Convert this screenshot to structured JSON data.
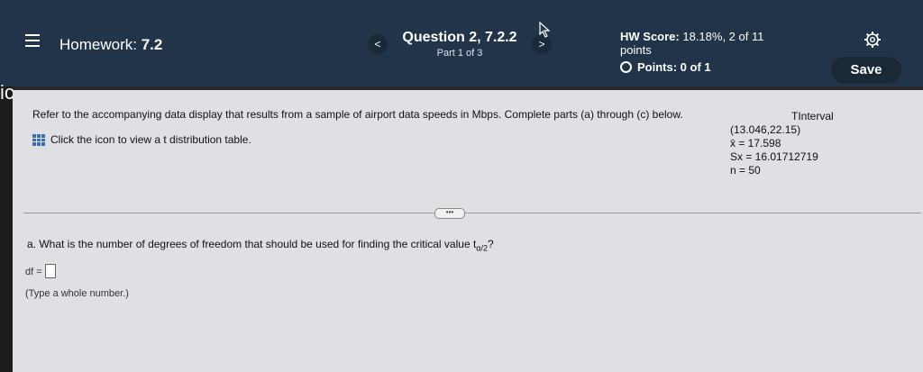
{
  "header": {
    "homework_label": "Homework:",
    "homework_number": "7.2",
    "question_title": "Question 2, 7.2.2",
    "question_part": "Part 1 of 3",
    "prev_label": "<",
    "next_label": ">",
    "hw_score_label": "HW Score:",
    "hw_score_value": "18.18%, 2 of 11",
    "hw_score_points_word": "points",
    "points_label": "Points: 0 of 1",
    "save_label": "Save"
  },
  "left_fragment": "ic",
  "problem": {
    "text": "Refer to the accompanying data display that results from a sample of airport data speeds in Mbps. Complete parts (a) through (c) below.",
    "table_link": "Click the icon to view a t distribution table."
  },
  "tinterval": {
    "title": "TInterval",
    "interval": "(13.046,22.15)",
    "xbar": "x̄ = 17.598",
    "sx": "Sx = 16.01712719",
    "n": "n = 50"
  },
  "more_button": "•••",
  "part_a": {
    "question_prefix": "a. What is the number of degrees of freedom that should be used for finding the critical value t",
    "subscript": "α/2",
    "question_suffix": "?",
    "df_label": "df =",
    "df_value": "",
    "hint": "(Type a whole number.)"
  }
}
